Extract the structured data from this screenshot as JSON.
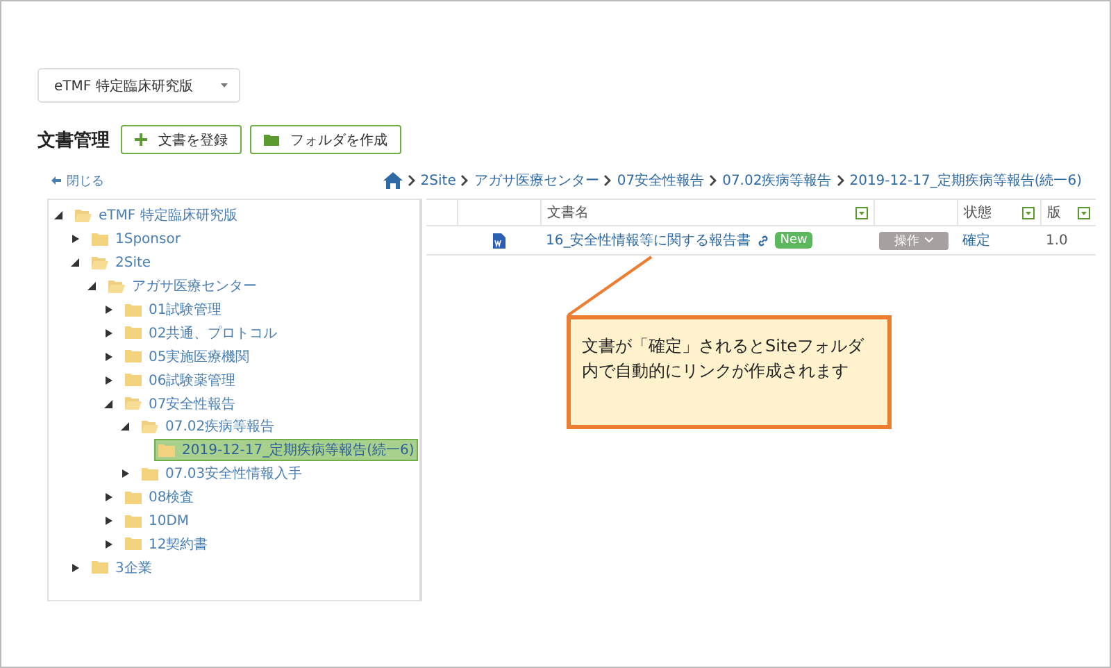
{
  "project_select": {
    "value": "eTMF 特定臨床研究版"
  },
  "page_title": "文書管理",
  "buttons": [
    {
      "kind": "plus",
      "label": "文書を登録"
    },
    {
      "kind": "folder",
      "label": "フォルダを作成"
    }
  ],
  "close_link": "閉じる",
  "breadcrumb": [
    "2Site",
    "アガサ医療センター",
    "07安全性報告",
    "07.02疾病等報告",
    "2019-12-17_定期疾病等報告(続一6)"
  ],
  "tree": [
    {
      "label": "eTMF 特定臨床研究版",
      "expanded": true,
      "selected": false,
      "children": [
        {
          "label": "1Sponsor",
          "expanded": false,
          "selected": false
        },
        {
          "label": "2Site",
          "expanded": true,
          "selected": false,
          "children": [
            {
              "label": "アガサ医療センター",
              "expanded": true,
              "selected": false,
              "children": [
                {
                  "label": "01試験管理",
                  "expanded": false,
                  "selected": false
                },
                {
                  "label": "02共通、プロトコル",
                  "expanded": false,
                  "selected": false
                },
                {
                  "label": "05実施医療機関",
                  "expanded": false,
                  "selected": false
                },
                {
                  "label": "06試験薬管理",
                  "expanded": false,
                  "selected": false
                },
                {
                  "label": "07安全性報告",
                  "expanded": true,
                  "selected": false,
                  "children": [
                    {
                      "label": "07.02疾病等報告",
                      "expanded": true,
                      "selected": false,
                      "children": [
                        {
                          "label": "2019-12-17_定期疾病等報告(続一6)",
                          "expanded": false,
                          "selected": true,
                          "leaf": true
                        }
                      ]
                    },
                    {
                      "label": "07.03安全性情報入手",
                      "expanded": false,
                      "selected": false
                    }
                  ]
                },
                {
                  "label": "08検査",
                  "expanded": false,
                  "selected": false
                },
                {
                  "label": "10DM",
                  "expanded": false,
                  "selected": false
                },
                {
                  "label": "12契約書",
                  "expanded": false,
                  "selected": false
                }
              ]
            }
          ]
        },
        {
          "label": "3企業",
          "expanded": false,
          "selected": false
        }
      ]
    }
  ],
  "table": {
    "columns": [
      {
        "filter": false
      },
      {
        "filter": false
      },
      {
        "label": "文書名",
        "filter": true
      },
      {
        "filter": false
      },
      {
        "label": "状態",
        "filter": true
      },
      {
        "label": "版",
        "filter": true
      }
    ],
    "rows": [
      {
        "name": "16_安全性情報等に関する報告書",
        "linked": true,
        "badge": "New",
        "action": "操作",
        "status": "確定",
        "version": "1.0"
      }
    ]
  },
  "callout": "文書が「確定」されるとSiteフォルダ内で自動的にリンクが作成されます"
}
